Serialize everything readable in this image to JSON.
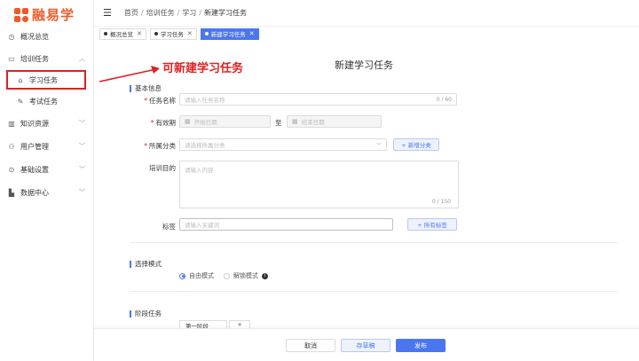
{
  "brand": {
    "name": "融易学",
    "color": "#f05a28"
  },
  "accent": "#4a76f0",
  "sidebar": {
    "items": [
      {
        "label": "概况总览",
        "icon": "dashboard-icon"
      },
      {
        "label": "培训任务",
        "icon": "folder-icon",
        "expanded": true
      },
      {
        "label": "学习任务",
        "icon": "graduation-cap-icon",
        "selected": true
      },
      {
        "label": "考试任务",
        "icon": "pen-icon"
      },
      {
        "label": "知识资源",
        "icon": "book-icon"
      },
      {
        "label": "用户管理",
        "icon": "users-icon"
      },
      {
        "label": "基础设置",
        "icon": "settings-icon"
      },
      {
        "label": "数据中心",
        "icon": "chart-icon"
      }
    ]
  },
  "header": {
    "breadcrumb": [
      "首页",
      "培训任务",
      "学习",
      "新建学习任务"
    ]
  },
  "tabs": [
    {
      "label": "概况总览",
      "active": false
    },
    {
      "label": "学习任务",
      "active": false
    },
    {
      "label": "新建学习任务",
      "active": true
    }
  ],
  "annotation": {
    "text": "可新建学习任务",
    "color": "#e02020"
  },
  "form": {
    "title": "新建学习任务",
    "basic_section": "基本信息",
    "name_label": "任务名称",
    "name_placeholder": "请输入任务名称",
    "name_counter": "0 / 60",
    "validity_label": "有效期",
    "start_placeholder": "开始日期",
    "range_sep": "至",
    "end_placeholder": "结束日期",
    "category_label": "所属分类",
    "category_placeholder": "请选择所属分类",
    "add_category_button": "+ 新增分类",
    "goal_label": "培训目的",
    "goal_placeholder": "请输入内容",
    "goal_counter": "0 / 150",
    "tags_label": "标签",
    "tags_placeholder": "请输入关键词",
    "all_tags_button": "+ 所有标签",
    "mode_section": "选择模式",
    "mode_free": "自由模式",
    "mode_unlock": "解锁模式",
    "stage_section": "阶段任务",
    "stage_tab": "第一阶段",
    "stage_add": "+"
  },
  "footer": {
    "cancel": "取消",
    "draft": "存草稿",
    "publish": "发布"
  }
}
